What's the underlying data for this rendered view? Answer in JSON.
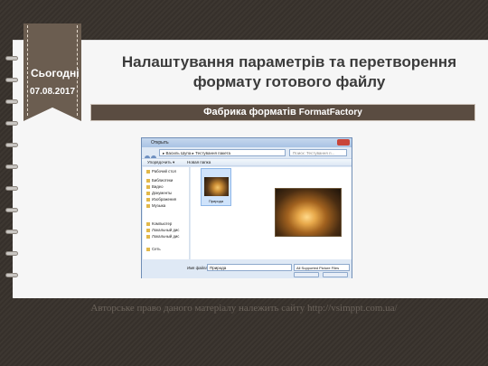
{
  "slide": {
    "badge": {
      "today": "Сьогодні",
      "date": "07.08.2017"
    },
    "title": "Налаштування параметрів та перетворення формату готового файлу",
    "subtitle": {
      "ua": "Фабрика форматів",
      "en": "FormatFactory"
    },
    "footer": "Авторське право даного матеріалу належить сайту http://vsimppt.com.ua/"
  },
  "dialog": {
    "title": "Открыть",
    "address": "▸ Василь Шупа ▸ Тестування пакета",
    "search_placeholder": "Поиск: Тестування п...",
    "toolbar": {
      "organize": "Упорядочить ▾",
      "new_folder": "Новая папка"
    },
    "nav": [
      {
        "label": "Рабочий стол"
      },
      {
        "label": "Библиотеки"
      },
      {
        "label": "Видео"
      },
      {
        "label": "Документы"
      },
      {
        "label": "Изображения"
      },
      {
        "label": "Музыка"
      },
      {
        "label": "Компьютер"
      },
      {
        "label": "Локальный дис"
      },
      {
        "label": "Локальный дис"
      },
      {
        "label": "Сеть"
      }
    ],
    "file": {
      "name": "Природа"
    },
    "filename_label": "Имя файла:",
    "filename_value": "Природа",
    "filetype_value": "All Supported Picture Files"
  }
}
